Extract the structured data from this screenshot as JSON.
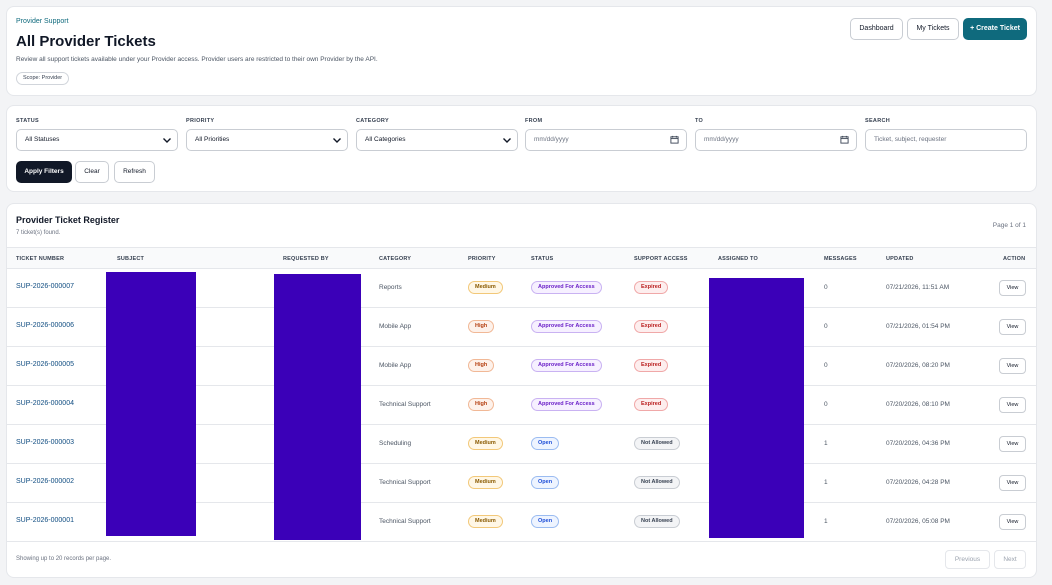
{
  "header": {
    "eyebrow": "Provider Support",
    "title": "All Provider Tickets",
    "description": "Review all support tickets available under your Provider access. Provider users are restricted to their own Provider by the API.",
    "scope_badge": "Scope: Provider",
    "buttons": {
      "dashboard": "Dashboard",
      "my_tickets": "My Tickets",
      "create": "+ Create Ticket"
    }
  },
  "filters": {
    "status": {
      "label": "STATUS",
      "value": "All Statuses"
    },
    "priority": {
      "label": "PRIORITY",
      "value": "All Priorities"
    },
    "category": {
      "label": "CATEGORY",
      "value": "All Categories"
    },
    "from": {
      "label": "FROM",
      "placeholder": "mm/dd/yyyy"
    },
    "to": {
      "label": "TO",
      "placeholder": "mm/dd/yyyy"
    },
    "search": {
      "label": "SEARCH",
      "placeholder": "Ticket, subject, requester"
    },
    "buttons": {
      "apply": "Apply Filters",
      "clear": "Clear",
      "refresh": "Refresh"
    }
  },
  "register": {
    "title": "Provider Ticket Register",
    "count_text": "7 ticket(s) found.",
    "page_text": "Page 1 of 1",
    "columns": {
      "ticket_number": "TICKET NUMBER",
      "subject": "SUBJECT",
      "requested_by": "REQUESTED BY",
      "category": "CATEGORY",
      "priority": "PRIORITY",
      "status": "STATUS",
      "support_access": "SUPPORT ACCESS",
      "assigned_to": "ASSIGNED TO",
      "messages": "MESSAGES",
      "updated": "UPDATED",
      "action": "ACTION"
    },
    "rows": [
      {
        "ticket": "SUP-2026-000007",
        "category": "Reports",
        "priority": "Medium",
        "status": "Approved For Access",
        "access": "Expired",
        "messages": "0",
        "updated": "07/21/2026, 11:51 AM",
        "action": "View"
      },
      {
        "ticket": "SUP-2026-000006",
        "category": "Mobile App",
        "priority": "High",
        "status": "Approved For Access",
        "access": "Expired",
        "messages": "0",
        "updated": "07/21/2026, 01:54 PM",
        "action": "View"
      },
      {
        "ticket": "SUP-2026-000005",
        "category": "Mobile App",
        "priority": "High",
        "status": "Approved For Access",
        "access": "Expired",
        "messages": "0",
        "updated": "07/20/2026, 08:20 PM",
        "action": "View"
      },
      {
        "ticket": "SUP-2026-000004",
        "category": "Technical Support",
        "priority": "High",
        "status": "Approved For Access",
        "access": "Expired",
        "messages": "0",
        "updated": "07/20/2026, 08:10 PM",
        "action": "View"
      },
      {
        "ticket": "SUP-2026-000003",
        "category": "Scheduling",
        "priority": "Medium",
        "status": "Open",
        "access": "Not Allowed",
        "messages": "1",
        "updated": "07/20/2026, 04:36 PM",
        "action": "View"
      },
      {
        "ticket": "SUP-2026-000002",
        "category": "Technical Support",
        "priority": "Medium",
        "status": "Open",
        "access": "Not Allowed",
        "messages": "1",
        "updated": "07/20/2026, 04:28 PM",
        "action": "View"
      },
      {
        "ticket": "SUP-2026-000001",
        "category": "Technical Support",
        "priority": "Medium",
        "status": "Open",
        "access": "Not Allowed",
        "messages": "1",
        "updated": "07/20/2026, 05:08 PM",
        "action": "View"
      }
    ],
    "footer_text": "Showing up to 20 records per page.",
    "pagination": {
      "previous": "Previous",
      "next": "Next"
    }
  },
  "colors": {
    "accent": "#0f6a7d",
    "dark": "#111827",
    "redaction": "#3b00b8"
  }
}
